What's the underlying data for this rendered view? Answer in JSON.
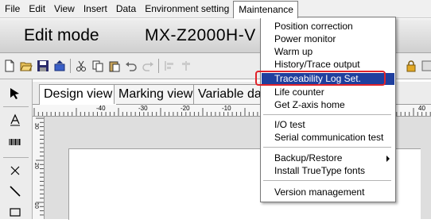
{
  "menubar": {
    "items": [
      "File",
      "Edit",
      "View",
      "Insert",
      "Data",
      "Environment setting",
      "Maintenance"
    ]
  },
  "titlebar": {
    "mode": "Edit mode",
    "model": "MX-Z2000H-V"
  },
  "toolbar": {
    "icons": [
      "new-file-icon",
      "open-folder-icon",
      "save-icon",
      "transfer-icon",
      "cut-icon",
      "copy-icon",
      "paste-icon",
      "undo-icon",
      "redo-icon",
      "align-icon",
      "lock-icon"
    ]
  },
  "left_tools": {
    "icons": [
      "pointer-icon",
      "text-icon",
      "barcode-icon",
      "cross-icon",
      "line-icon",
      "rectangle-icon"
    ]
  },
  "tabs": [
    "Design view",
    "Marking view",
    "Variable da"
  ],
  "ruler": {
    "h_labels": [
      "-40",
      "-30",
      "-20",
      "-10",
      "40"
    ],
    "v_labels": [
      "30",
      "20",
      "10",
      "0"
    ]
  },
  "maintenance_menu": {
    "items": [
      {
        "label": "Position correction"
      },
      {
        "label": "Power monitor"
      },
      {
        "label": "Warm up"
      },
      {
        "label": "History/Trace output"
      },
      {
        "label": "Traceability Log Set.",
        "highlighted": true
      },
      {
        "label": "Life counter"
      },
      {
        "label": "Get Z-axis home"
      },
      {
        "label": "I/O test"
      },
      {
        "label": "Serial communication test"
      },
      {
        "label": "Backup/Restore",
        "submenu": true
      },
      {
        "label": "Install TrueType fonts"
      },
      {
        "label": "Version management"
      }
    ]
  },
  "colors": {
    "highlight": "#1f3f9e",
    "callout": "#e0232a"
  }
}
